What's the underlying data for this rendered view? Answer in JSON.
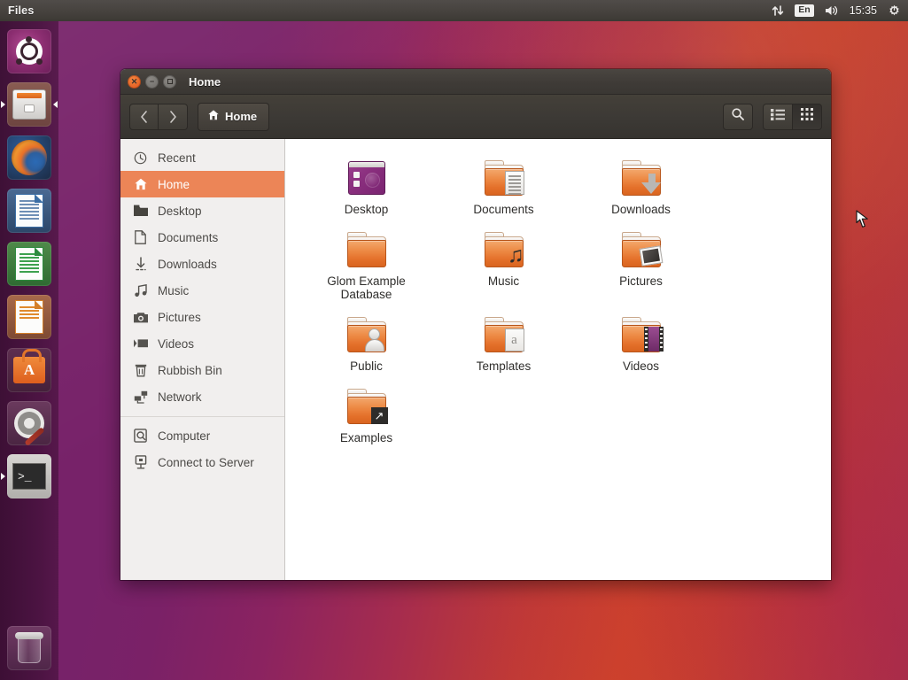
{
  "panel": {
    "app_title": "Files",
    "indicators": {
      "network_icon": "network-transfer-icon",
      "keyboard_layout": "En",
      "volume_icon": "volume-icon",
      "clock": "15:35",
      "session_icon": "gear-power-icon"
    }
  },
  "launcher": {
    "items": [
      {
        "name": "ubuntu-dash",
        "label": "Dash home",
        "icon": "ubuntu-logo-icon",
        "running": false
      },
      {
        "name": "files",
        "label": "Files",
        "icon": "file-manager-icon",
        "running": true,
        "focused": true
      },
      {
        "name": "firefox",
        "label": "Firefox Web Browser",
        "icon": "firefox-icon",
        "running": false
      },
      {
        "name": "writer",
        "label": "LibreOffice Writer",
        "icon": "libreoffice-writer-icon",
        "running": false
      },
      {
        "name": "calc",
        "label": "LibreOffice Calc",
        "icon": "libreoffice-calc-icon",
        "running": false
      },
      {
        "name": "impress",
        "label": "LibreOffice Impress",
        "icon": "libreoffice-impress-icon",
        "running": false
      },
      {
        "name": "software",
        "label": "Ubuntu Software",
        "icon": "software-centre-icon",
        "running": false
      },
      {
        "name": "settings",
        "label": "System Settings",
        "icon": "system-settings-icon",
        "running": false
      },
      {
        "name": "terminal",
        "label": "Terminal",
        "icon": "terminal-icon",
        "running": true
      }
    ],
    "trash": {
      "label": "Rubbish Bin",
      "icon": "trash-icon"
    }
  },
  "window": {
    "title": "Home",
    "buttons": {
      "close": "close-button",
      "minimise": "minimise-button",
      "maximise": "maximise-button"
    },
    "toolbar": {
      "back_label": "‹",
      "forward_label": "›",
      "path_label": "Home",
      "path_icon": "home-icon",
      "search_icon": "search-icon",
      "list_view_icon": "list-view-icon",
      "grid_view_icon": "grid-view-icon",
      "active_view": "grid"
    },
    "sidebar": {
      "places": [
        {
          "label": "Recent",
          "icon": "clock-icon",
          "selected": false
        },
        {
          "label": "Home",
          "icon": "home-icon",
          "selected": true
        },
        {
          "label": "Desktop",
          "icon": "folder-icon",
          "selected": false
        },
        {
          "label": "Documents",
          "icon": "document-icon",
          "selected": false
        },
        {
          "label": "Downloads",
          "icon": "download-icon",
          "selected": false
        },
        {
          "label": "Music",
          "icon": "music-note-icon",
          "selected": false
        },
        {
          "label": "Pictures",
          "icon": "camera-icon",
          "selected": false
        },
        {
          "label": "Videos",
          "icon": "film-icon",
          "selected": false
        },
        {
          "label": "Rubbish Bin",
          "icon": "trash-icon",
          "selected": false
        },
        {
          "label": "Network",
          "icon": "network-icon",
          "selected": false
        }
      ],
      "devices": [
        {
          "label": "Computer",
          "icon": "computer-icon"
        },
        {
          "label": "Connect to Server",
          "icon": "server-icon"
        }
      ]
    },
    "files": [
      {
        "name": "Desktop",
        "icon": "desktop-preview-icon"
      },
      {
        "name": "Documents",
        "icon": "folder-documents-icon"
      },
      {
        "name": "Downloads",
        "icon": "folder-downloads-icon"
      },
      {
        "name": "Glom Example Database",
        "icon": "folder-icon"
      },
      {
        "name": "Music",
        "icon": "folder-music-icon"
      },
      {
        "name": "Pictures",
        "icon": "folder-pictures-icon"
      },
      {
        "name": "Public",
        "icon": "folder-public-icon"
      },
      {
        "name": "Templates",
        "icon": "folder-templates-icon"
      },
      {
        "name": "Videos",
        "icon": "folder-videos-icon"
      },
      {
        "name": "Examples",
        "icon": "folder-link-icon"
      }
    ]
  },
  "colors": {
    "ubuntu_orange": "#e95420",
    "selection_orange": "#ec8557",
    "aubergine": "#77216f",
    "panel_grey": "#3f3b37",
    "sidebar_grey": "#f1efee"
  }
}
